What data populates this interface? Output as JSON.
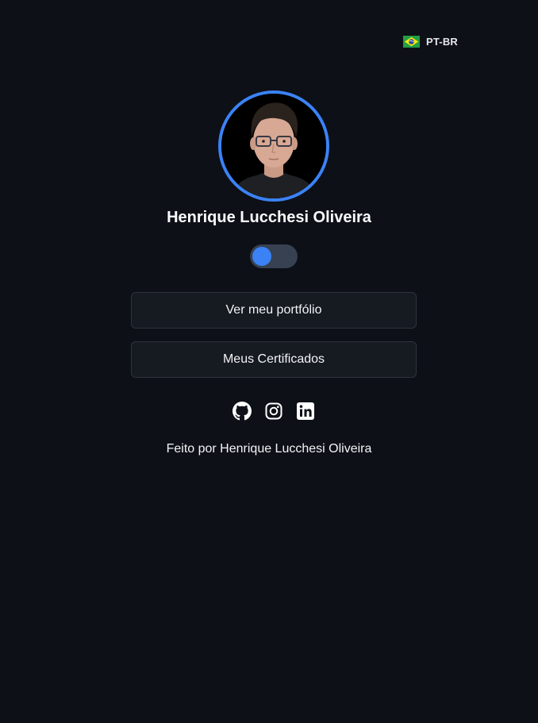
{
  "header": {
    "language": {
      "label": "PT-BR",
      "flag": "brazil-flag-icon"
    }
  },
  "profile": {
    "name": "Henrique Lucchesi Oliveira",
    "avatar_border_color": "#3b82f6"
  },
  "theme_toggle": {
    "state": "off",
    "knob_color": "#3b82f6",
    "track_color": "#374151"
  },
  "links": {
    "portfolio_label": "Ver meu portfólio",
    "certificates_label": "Meus Certificados"
  },
  "socials": [
    {
      "name": "GitHub",
      "icon": "github-icon"
    },
    {
      "name": "Instagram",
      "icon": "instagram-icon"
    },
    {
      "name": "LinkedIn",
      "icon": "linkedin-icon"
    }
  ],
  "footer": {
    "text": "Feito por Henrique Lucchesi Oliveira"
  },
  "colors": {
    "background": "#0d1017",
    "button_background": "#161a21",
    "button_border": "#2d333d",
    "accent": "#3b82f6"
  }
}
